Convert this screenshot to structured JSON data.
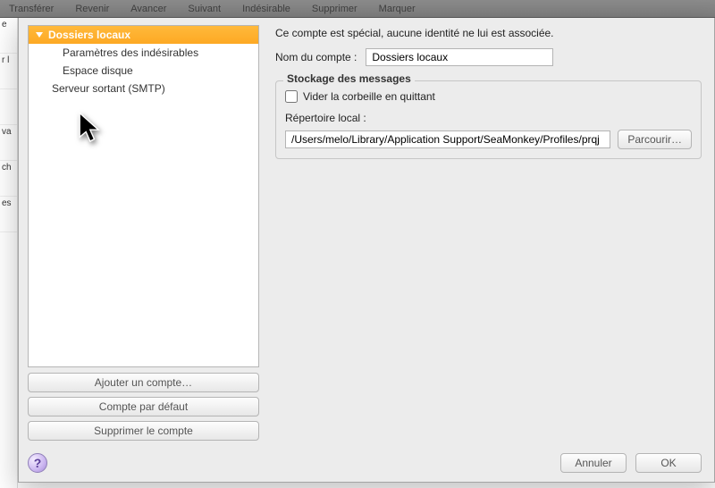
{
  "toolbar": {
    "items": [
      "Transférer",
      "Revenir",
      "Avancer",
      "Suivant",
      "Indésirable",
      "Supprimer",
      "Marquer"
    ]
  },
  "tree": {
    "group_label": "Dossiers locaux",
    "items": [
      {
        "label": "Paramètres des indésirables"
      },
      {
        "label": "Espace disque"
      }
    ],
    "smtp_label": "Serveur sortant (SMTP)"
  },
  "left_buttons": {
    "add": "Ajouter un compte…",
    "default": "Compte par défaut",
    "delete": "Supprimer le compte"
  },
  "settings": {
    "desc": "Ce compte est spécial, aucune identité ne lui est associée.",
    "name_label": "Nom du compte :",
    "name_value": "Dossiers locaux",
    "storage_title": "Stockage des messages",
    "empty_trash_label": "Vider la corbeille en quittant",
    "empty_trash_checked": false,
    "local_dir_label": "Répertoire local :",
    "local_dir_value": "/Users/melo/Library/Application Support/SeaMonkey/Profiles/prqj",
    "browse_label": "Parcourir…"
  },
  "footer": {
    "help": "?",
    "cancel": "Annuler",
    "ok": "OK"
  }
}
